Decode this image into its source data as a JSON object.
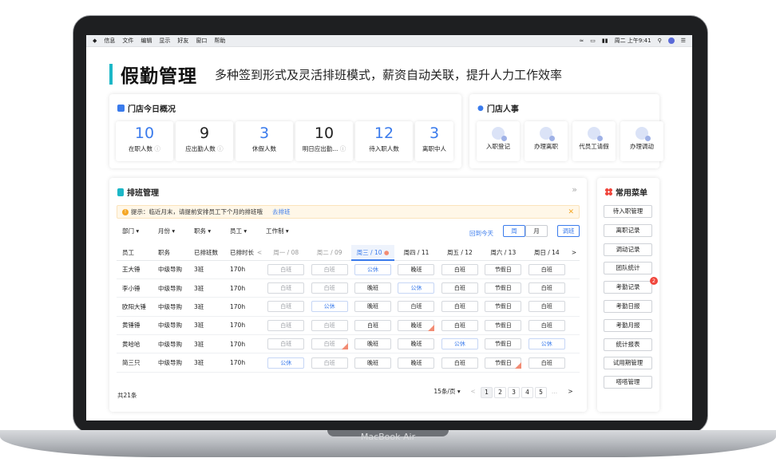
{
  "device": {
    "label": "MacBook Air"
  },
  "menubar": {
    "items": [
      "信息",
      "文件",
      "编辑",
      "显示",
      "好友",
      "窗口",
      "帮助"
    ],
    "clock": "周二 上午9:41"
  },
  "header": {
    "title": "假勤管理",
    "subtitle": "多种签到形式及灵活排班模式，薪资自动关联，提升人力工作效率"
  },
  "overview": {
    "title": "门店今日概况",
    "stats": [
      {
        "value": "10",
        "label": "在职人数",
        "info": true
      },
      {
        "value": "9",
        "label": "应出勤人数",
        "info": true
      },
      {
        "value": "3",
        "label": "休假人数",
        "info": false
      },
      {
        "value": "10",
        "label": "明日应出勤...",
        "info": true
      },
      {
        "value": "12",
        "label": "待入职人数",
        "info": false
      },
      {
        "value": "3",
        "label": "离职中人",
        "info": false
      }
    ]
  },
  "hr": {
    "title": "门店人事",
    "items": [
      "入职登记",
      "办理离职",
      "代员工请假",
      "办理调动"
    ]
  },
  "schedule": {
    "title": "排班管理",
    "tip": "提示：临近月末，请提前安排员工下个月的排班哦",
    "tip_link": "去排班",
    "filters": [
      "部门 ▾",
      "月份 ▾",
      "职务 ▾",
      "员工 ▾",
      "工作制 ▾"
    ],
    "back_today": "回到今天",
    "week": "周",
    "month": "月",
    "adjust": "调班",
    "columns": [
      "员工",
      "职务",
      "已排班数",
      "已排时长"
    ],
    "days": [
      "周一 / 08",
      "周二 / 09",
      "周三 / 10",
      "周四 / 11",
      "周五 / 12",
      "周六 / 13",
      "周日 / 14"
    ],
    "prev": "<",
    "next": ">",
    "rows": [
      {
        "name": "王大锤",
        "role": "中级导购",
        "count": "3班",
        "hours": "170h",
        "shifts": [
          "白班",
          "白班",
          "公休",
          "晚班",
          "白班",
          "节假日",
          "白班"
        ]
      },
      {
        "name": "李小锤",
        "role": "中级导购",
        "count": "3班",
        "hours": "170h",
        "shifts": [
          "白班",
          "白班",
          "晚班",
          "公休",
          "白班",
          "节假日",
          "白班"
        ]
      },
      {
        "name": "欧阳大锤",
        "role": "中级导购",
        "count": "3班",
        "hours": "170h",
        "shifts": [
          "白班",
          "公休",
          "晚班",
          "白班",
          "白班",
          "节假日",
          "白班"
        ]
      },
      {
        "name": "黄锤锤",
        "role": "中级导购",
        "count": "3班",
        "hours": "170h",
        "shifts": [
          "白班",
          "白班",
          "白班",
          "晚班",
          "白班",
          "节假日",
          "白班"
        ]
      },
      {
        "name": "黄哈哈",
        "role": "中级导购",
        "count": "3班",
        "hours": "170h",
        "shifts": [
          "白班",
          "白班",
          "晚班",
          "晚班",
          "公休",
          "节假日",
          "公休"
        ]
      },
      {
        "name": "简三只",
        "role": "中级导购",
        "count": "3班",
        "hours": "170h",
        "shifts": [
          "公休",
          "白班",
          "晚班",
          "晚班",
          "白班",
          "节假日",
          "白班"
        ]
      }
    ],
    "total": "共21条",
    "page_size": "15条/页 ▾",
    "pages": [
      "<",
      "1",
      "2",
      "3",
      "4",
      "5",
      "...",
      ">"
    ]
  },
  "common_menu": {
    "title": "常用菜单",
    "items": [
      "待入职管理",
      "离职记录",
      "调动记录",
      "团队统计",
      "考勤记录",
      "考勤日报",
      "考勤月报",
      "统计报表",
      "试用期管理",
      "嗒嗒管理"
    ],
    "badge": "2"
  },
  "colors": {
    "accent": "#1cb7c7",
    "blue": "#3a7bec",
    "alert": "#f0463c"
  }
}
